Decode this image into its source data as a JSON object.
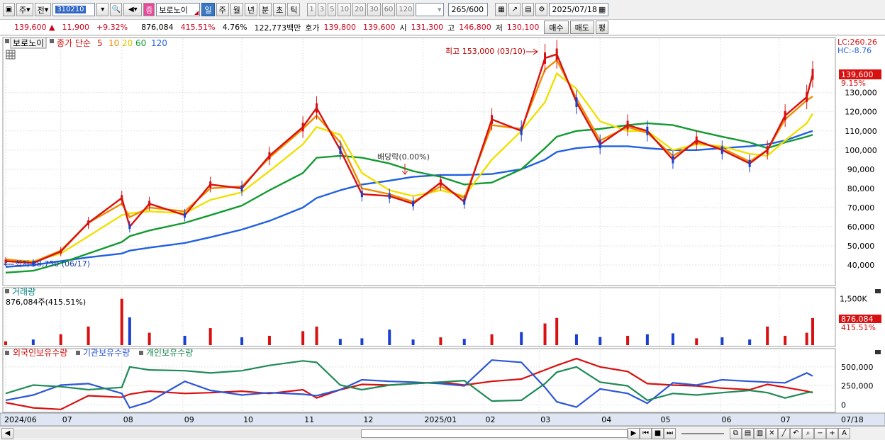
{
  "toolbar": {
    "period_buttons": [
      "주",
      "전"
    ],
    "code": "310210",
    "badge": "증",
    "stock_name": "보로노이",
    "timeframes": [
      "일",
      "주",
      "월",
      "년",
      "분",
      "초",
      "틱"
    ],
    "timeframe_selected": "일",
    "minute_options": [
      "1",
      "3",
      "5",
      "10",
      "20",
      "30",
      "60",
      "120"
    ],
    "count": "265",
    "count_total": "/600",
    "date": "2025/07/18"
  },
  "info": {
    "price": "139,600",
    "arrow": "▲",
    "change": "11,900",
    "change_pct": "+9.32%",
    "volume": "876,084",
    "volume_ratio": "415.51%",
    "turnover": "4.76%",
    "amount": "122,773백만",
    "quote_label": "호가",
    "ask": "139,800",
    "bid": "139,600",
    "open_label": "시",
    "open": "131,300",
    "high_label": "고",
    "high": "146,800",
    "low_label": "저",
    "low": "130,100",
    "buy_btn": "매수",
    "sell_btn": "매도",
    "eval_btn": "평"
  },
  "legend": {
    "stock": "보로노이",
    "ma_title": "종가 단순",
    "ma_periods": [
      "5",
      "10",
      "20",
      "60",
      "120"
    ],
    "ma_colors": [
      "#d81010",
      "#f08c00",
      "#f0e000",
      "#129a30",
      "#2060e0"
    ]
  },
  "right_labels": {
    "lc": "LC:260.26",
    "hc": "HC:-8.76",
    "price_tag": "139,600",
    "pct_tag": "9.15%",
    "vol_tag": "876,084",
    "vol_pct_tag": "415.51%"
  },
  "annotations": {
    "high": "최고 153,000 (03/10)",
    "low": "최저 38,750 (06/17)",
    "dividend": "배당락(0.00%)"
  },
  "volume_panel": {
    "title": "거래량",
    "value": "876,084주(415.51%)"
  },
  "holdings_panel": {
    "labels": [
      "외국인보유수량",
      "기관보유수량",
      "개인보유수량"
    ]
  },
  "x_axis_labels": [
    "2024/06",
    "07",
    "08",
    "09",
    "10",
    "11",
    "12",
    "2025/01",
    "02",
    "03",
    "04",
    "05",
    "06",
    "07",
    "07/18"
  ],
  "chart_data": [
    {
      "type": "candlestick",
      "title": "",
      "y_ticks": [
        40000,
        50000,
        60000,
        70000,
        80000,
        90000,
        100000,
        110000,
        120000,
        130000
      ],
      "ylim": [
        30000,
        158000
      ],
      "x": [
        "2024-06-03",
        "2024-06-17",
        "2024-07-01",
        "2024-07-15",
        "2024-08-01",
        "2024-08-05",
        "2024-08-15",
        "2024-09-02",
        "2024-09-15",
        "2024-10-01",
        "2024-10-15",
        "2024-11-01",
        "2024-11-08",
        "2024-11-20",
        "2024-12-01",
        "2024-12-15",
        "2024-12-27",
        "2025-01-10",
        "2025-01-22",
        "2025-02-05",
        "2025-02-20",
        "2025-03-04",
        "2025-03-10",
        "2025-03-20",
        "2025-04-01",
        "2025-04-15",
        "2025-04-25",
        "2025-05-08",
        "2025-05-20",
        "2025-06-02",
        "2025-06-16",
        "2025-06-25",
        "2025-07-04",
        "2025-07-15",
        "2025-07-18"
      ],
      "close": [
        42000,
        41000,
        47000,
        62000,
        75000,
        60000,
        72000,
        66000,
        82000,
        80000,
        97000,
        112000,
        122000,
        100000,
        77000,
        76000,
        72000,
        83000,
        73000,
        116000,
        110000,
        148000,
        150000,
        125000,
        103000,
        113000,
        110000,
        95000,
        105000,
        100000,
        93000,
        100000,
        118000,
        127700,
        139600
      ],
      "ma5": [
        43000,
        41500,
        47500,
        62000,
        72000,
        65000,
        70000,
        68000,
        80000,
        81000,
        96000,
        111000,
        118000,
        104000,
        80000,
        77000,
        73000,
        81000,
        75000,
        113000,
        111000,
        142000,
        147000,
        127000,
        105000,
        112000,
        109000,
        97000,
        104000,
        101000,
        94000,
        100000,
        116000,
        126000,
        128000
      ],
      "ma20": [
        42500,
        42000,
        46000,
        55000,
        66000,
        67000,
        68000,
        67000,
        74000,
        78000,
        89000,
        103000,
        112000,
        108000,
        88000,
        79000,
        76000,
        79000,
        76000,
        95000,
        110000,
        125000,
        140000,
        132000,
        115000,
        110000,
        110000,
        100000,
        103000,
        102000,
        98000,
        97000,
        105000,
        114000,
        119000
      ],
      "ma60": [
        36000,
        37000,
        41000,
        46000,
        52000,
        55000,
        58000,
        62000,
        66000,
        71000,
        79000,
        88000,
        96000,
        97000,
        96000,
        93000,
        89000,
        86000,
        82000,
        83000,
        90000,
        101000,
        107000,
        110000,
        111000,
        113000,
        114000,
        113000,
        110000,
        107000,
        104000,
        101000,
        104000,
        107000,
        108000
      ],
      "ma120": [
        39000,
        40000,
        42000,
        44000,
        46000,
        47500,
        49000,
        51500,
        54500,
        58500,
        63000,
        70000,
        75000,
        79000,
        82000,
        84000,
        86000,
        87000,
        87000,
        87500,
        90000,
        95000,
        99000,
        101000,
        102000,
        102000,
        101000,
        100000,
        100000,
        101000,
        102000,
        103000,
        105000,
        109000,
        110000
      ]
    },
    {
      "type": "bar",
      "title": "거래량",
      "y_ticks": [
        1500000
      ],
      "series": [
        {
          "name": "거래량",
          "values": [
            120000,
            180000,
            350000,
            600000,
            1500000,
            900000,
            400000,
            300000,
            550000,
            250000,
            300000,
            450000,
            600000,
            200000,
            220000,
            500000,
            180000,
            250000,
            200000,
            350000,
            420000,
            700000,
            880000,
            350000,
            260000,
            300000,
            350000,
            380000,
            220000,
            250000,
            180000,
            600000,
            300000,
            400000,
            876084
          ]
        }
      ]
    },
    {
      "type": "line",
      "title": "",
      "y_ticks": [
        0,
        250000,
        500000
      ],
      "ylim": [
        -90000,
        620000
      ],
      "series": [
        {
          "name": "외국인보유수량",
          "color": "#d81010",
          "values": [
            30000,
            -40000,
            -60000,
            120000,
            100000,
            140000,
            180000,
            150000,
            160000,
            180000,
            150000,
            200000,
            90000,
            200000,
            270000,
            260000,
            280000,
            300000,
            260000,
            310000,
            340000,
            460000,
            520000,
            610000,
            500000,
            440000,
            280000,
            260000,
            250000,
            220000,
            200000,
            270000,
            230000,
            180000,
            160000
          ]
        },
        {
          "name": "기관보유수량",
          "color": "#2c56d8",
          "values": [
            60000,
            130000,
            260000,
            280000,
            150000,
            -40000,
            40000,
            310000,
            190000,
            130000,
            160000,
            140000,
            120000,
            200000,
            330000,
            310000,
            300000,
            280000,
            250000,
            590000,
            560000,
            230000,
            40000,
            -30000,
            210000,
            150000,
            20000,
            290000,
            260000,
            330000,
            310000,
            300000,
            290000,
            420000,
            380000
          ]
        },
        {
          "name": "개인보유수량",
          "color": "#1f8a56",
          "values": [
            150000,
            260000,
            240000,
            200000,
            230000,
            500000,
            460000,
            450000,
            420000,
            450000,
            520000,
            580000,
            560000,
            260000,
            200000,
            260000,
            280000,
            300000,
            320000,
            50000,
            60000,
            280000,
            430000,
            500000,
            300000,
            250000,
            60000,
            150000,
            130000,
            160000,
            190000,
            160000,
            90000,
            160000,
            170000
          ]
        }
      ]
    }
  ]
}
